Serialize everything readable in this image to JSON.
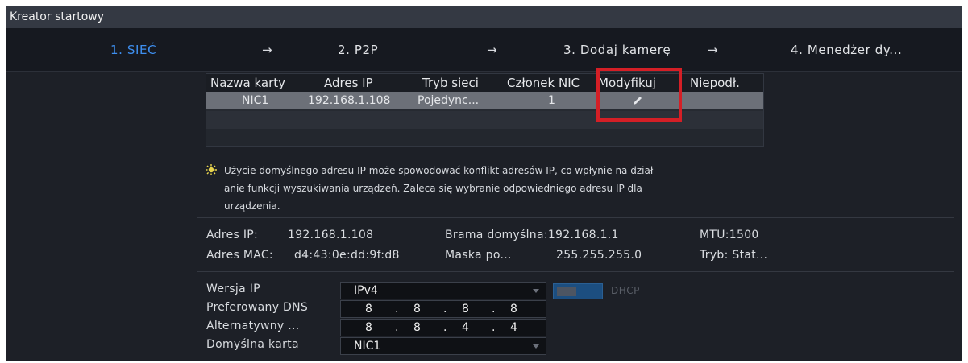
{
  "window": {
    "title": "Kreator startowy"
  },
  "steps": [
    {
      "label": "1. SIEĆ"
    },
    {
      "label": "2. P2P"
    },
    {
      "label": "3. Dodaj kamerę"
    },
    {
      "label": "4. Menedżer dy..."
    }
  ],
  "step_arrow": "→",
  "nic_table": {
    "columns": [
      "Nazwa karty",
      "Adres IP",
      "Tryb sieci",
      "Członek NIC",
      "Modyfikuj",
      "Niepodł."
    ],
    "rows": [
      {
        "name": "NIC1",
        "ip": "192.168.1.108",
        "mode": "Pojedync...",
        "member": "1"
      }
    ]
  },
  "notice": {
    "icon": "lightbulb-icon",
    "lines": [
      "Użycie domyślnego adresu IP może spowodować konflikt adresów IP, co wpłynie na dział",
      "anie funkcji wyszukiwania urządzeń. Zaleca się wybranie odpowiedniego adresu IP dla",
      "urządzenia."
    ]
  },
  "info": {
    "ip_label": "Adres IP:",
    "ip_value": "192.168.1.108",
    "gateway": "Brama domyślna:192.168.1.1",
    "mtu": "MTU:1500",
    "mac_label": "Adres MAC:",
    "mac_value": "d4:43:0e:dd:9f:d8",
    "mask_label": "Maska po...",
    "mask_value": "255.255.255.0",
    "mode": "Tryb: Stat..."
  },
  "form": {
    "ip_version_label": "Wersja IP",
    "ip_version_value": "IPv4",
    "dhcp_label": "DHCP",
    "pref_dns_label": "Preferowany DNS",
    "pref_dns": [
      "8",
      "8",
      "8",
      "8"
    ],
    "alt_dns_label": "Alternatywny ...",
    "alt_dns": [
      "8",
      "8",
      "4",
      "4"
    ],
    "default_card_label": "Domyślna karta",
    "default_card_value": "NIC1",
    "ip_separator": "."
  },
  "colors": {
    "active_step": "#3e8ff0",
    "highlight": "#d41f26",
    "selected_row": "#6c7078",
    "toggle": "#1c4e80"
  }
}
